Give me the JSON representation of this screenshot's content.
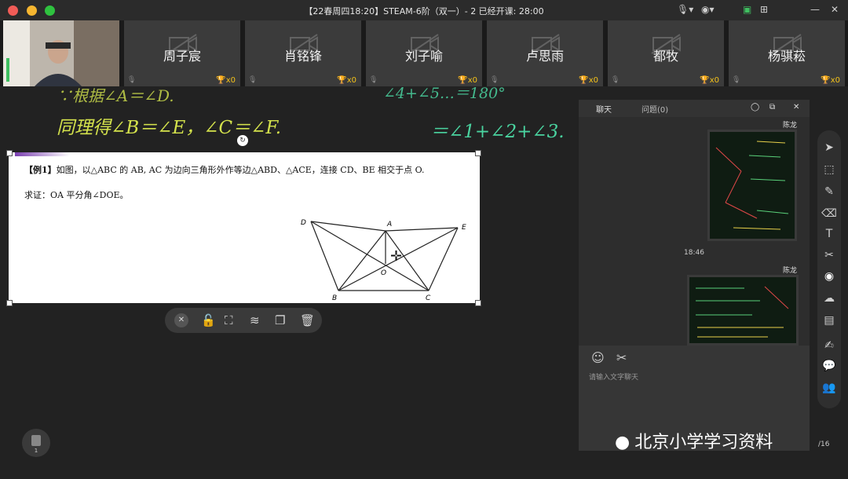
{
  "window": {
    "title": "【22春周四18:20】STEAM-6阶（双一）- 2    已经开课: 28:00",
    "colors": {
      "close": "#f15c57",
      "minimize": "#f6b630",
      "maximize": "#2fc23f"
    }
  },
  "participants": [
    {
      "name": "周子宸",
      "score": "x0"
    },
    {
      "name": "肖铭锋",
      "score": "x0"
    },
    {
      "name": "刘子喻",
      "score": "x0"
    },
    {
      "name": "卢思雨",
      "score": "x0"
    },
    {
      "name": "都牧",
      "score": "x0"
    },
    {
      "name": "杨骐菘",
      "score": "x0"
    }
  ],
  "board": {
    "handwriting": {
      "line1": "∵根据∠A＝∠D.",
      "line2": "同理得∠B＝∠E，∠C＝∠F.",
      "line3": "＝∠1+∠2+∠3.",
      "line_top": "∠4+∠5…＝180°"
    },
    "question": {
      "label": "【例1】",
      "text": "如图，以△ABC 的 AB, AC 为边向三角形外作等边△ABD、△ACE，连接 CD、BE 相交于点 O.",
      "prove": "求证：OA 平分角∠DOE。"
    },
    "figure_labels": {
      "D": "D",
      "A": "A",
      "E": "E",
      "O": "O",
      "B": "B",
      "C": "C"
    }
  },
  "toolbar": {
    "icons": [
      "close-icon",
      "lock-icon",
      "crop-icon",
      "layers-icon",
      "copy-icon",
      "delete-icon"
    ]
  },
  "chat": {
    "tabs": {
      "chat": "聊天",
      "questions": "问题(0)"
    },
    "messages": [
      {
        "sender": "陈龙"
      },
      {
        "time": "18:46"
      },
      {
        "sender": "陈龙"
      }
    ],
    "input_placeholder": "请输入文字聊天"
  },
  "side_tools": [
    "pointer-icon",
    "select-icon",
    "pen-icon",
    "eraser-icon",
    "text-icon",
    "scissors-icon",
    "camera-icon",
    "cloud-icon",
    "toolbox-icon",
    "edit-icon",
    "chat-icon",
    "users-icon"
  ],
  "page_indicator": {
    "page": "1",
    "count": "/16"
  },
  "watermark": "北京小学学习资料"
}
